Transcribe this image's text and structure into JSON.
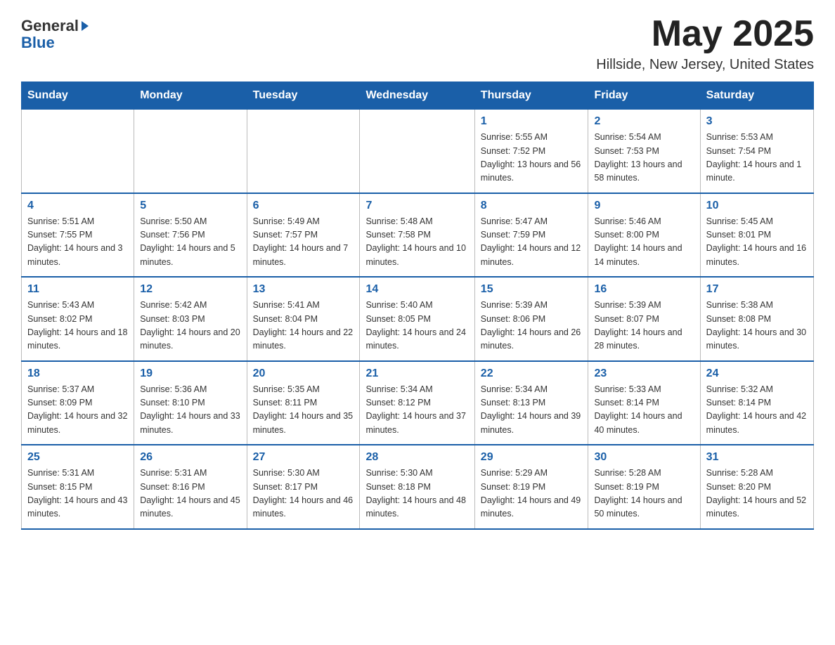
{
  "header": {
    "logo_line1": "General",
    "logo_line2": "Blue",
    "month_year": "May 2025",
    "location": "Hillside, New Jersey, United States"
  },
  "days_of_week": [
    "Sunday",
    "Monday",
    "Tuesday",
    "Wednesday",
    "Thursday",
    "Friday",
    "Saturday"
  ],
  "weeks": [
    [
      {
        "day": "",
        "info": ""
      },
      {
        "day": "",
        "info": ""
      },
      {
        "day": "",
        "info": ""
      },
      {
        "day": "",
        "info": ""
      },
      {
        "day": "1",
        "info": "Sunrise: 5:55 AM\nSunset: 7:52 PM\nDaylight: 13 hours and 56 minutes."
      },
      {
        "day": "2",
        "info": "Sunrise: 5:54 AM\nSunset: 7:53 PM\nDaylight: 13 hours and 58 minutes."
      },
      {
        "day": "3",
        "info": "Sunrise: 5:53 AM\nSunset: 7:54 PM\nDaylight: 14 hours and 1 minute."
      }
    ],
    [
      {
        "day": "4",
        "info": "Sunrise: 5:51 AM\nSunset: 7:55 PM\nDaylight: 14 hours and 3 minutes."
      },
      {
        "day": "5",
        "info": "Sunrise: 5:50 AM\nSunset: 7:56 PM\nDaylight: 14 hours and 5 minutes."
      },
      {
        "day": "6",
        "info": "Sunrise: 5:49 AM\nSunset: 7:57 PM\nDaylight: 14 hours and 7 minutes."
      },
      {
        "day": "7",
        "info": "Sunrise: 5:48 AM\nSunset: 7:58 PM\nDaylight: 14 hours and 10 minutes."
      },
      {
        "day": "8",
        "info": "Sunrise: 5:47 AM\nSunset: 7:59 PM\nDaylight: 14 hours and 12 minutes."
      },
      {
        "day": "9",
        "info": "Sunrise: 5:46 AM\nSunset: 8:00 PM\nDaylight: 14 hours and 14 minutes."
      },
      {
        "day": "10",
        "info": "Sunrise: 5:45 AM\nSunset: 8:01 PM\nDaylight: 14 hours and 16 minutes."
      }
    ],
    [
      {
        "day": "11",
        "info": "Sunrise: 5:43 AM\nSunset: 8:02 PM\nDaylight: 14 hours and 18 minutes."
      },
      {
        "day": "12",
        "info": "Sunrise: 5:42 AM\nSunset: 8:03 PM\nDaylight: 14 hours and 20 minutes."
      },
      {
        "day": "13",
        "info": "Sunrise: 5:41 AM\nSunset: 8:04 PM\nDaylight: 14 hours and 22 minutes."
      },
      {
        "day": "14",
        "info": "Sunrise: 5:40 AM\nSunset: 8:05 PM\nDaylight: 14 hours and 24 minutes."
      },
      {
        "day": "15",
        "info": "Sunrise: 5:39 AM\nSunset: 8:06 PM\nDaylight: 14 hours and 26 minutes."
      },
      {
        "day": "16",
        "info": "Sunrise: 5:39 AM\nSunset: 8:07 PM\nDaylight: 14 hours and 28 minutes."
      },
      {
        "day": "17",
        "info": "Sunrise: 5:38 AM\nSunset: 8:08 PM\nDaylight: 14 hours and 30 minutes."
      }
    ],
    [
      {
        "day": "18",
        "info": "Sunrise: 5:37 AM\nSunset: 8:09 PM\nDaylight: 14 hours and 32 minutes."
      },
      {
        "day": "19",
        "info": "Sunrise: 5:36 AM\nSunset: 8:10 PM\nDaylight: 14 hours and 33 minutes."
      },
      {
        "day": "20",
        "info": "Sunrise: 5:35 AM\nSunset: 8:11 PM\nDaylight: 14 hours and 35 minutes."
      },
      {
        "day": "21",
        "info": "Sunrise: 5:34 AM\nSunset: 8:12 PM\nDaylight: 14 hours and 37 minutes."
      },
      {
        "day": "22",
        "info": "Sunrise: 5:34 AM\nSunset: 8:13 PM\nDaylight: 14 hours and 39 minutes."
      },
      {
        "day": "23",
        "info": "Sunrise: 5:33 AM\nSunset: 8:14 PM\nDaylight: 14 hours and 40 minutes."
      },
      {
        "day": "24",
        "info": "Sunrise: 5:32 AM\nSunset: 8:14 PM\nDaylight: 14 hours and 42 minutes."
      }
    ],
    [
      {
        "day": "25",
        "info": "Sunrise: 5:31 AM\nSunset: 8:15 PM\nDaylight: 14 hours and 43 minutes."
      },
      {
        "day": "26",
        "info": "Sunrise: 5:31 AM\nSunset: 8:16 PM\nDaylight: 14 hours and 45 minutes."
      },
      {
        "day": "27",
        "info": "Sunrise: 5:30 AM\nSunset: 8:17 PM\nDaylight: 14 hours and 46 minutes."
      },
      {
        "day": "28",
        "info": "Sunrise: 5:30 AM\nSunset: 8:18 PM\nDaylight: 14 hours and 48 minutes."
      },
      {
        "day": "29",
        "info": "Sunrise: 5:29 AM\nSunset: 8:19 PM\nDaylight: 14 hours and 49 minutes."
      },
      {
        "day": "30",
        "info": "Sunrise: 5:28 AM\nSunset: 8:19 PM\nDaylight: 14 hours and 50 minutes."
      },
      {
        "day": "31",
        "info": "Sunrise: 5:28 AM\nSunset: 8:20 PM\nDaylight: 14 hours and 52 minutes."
      }
    ]
  ]
}
